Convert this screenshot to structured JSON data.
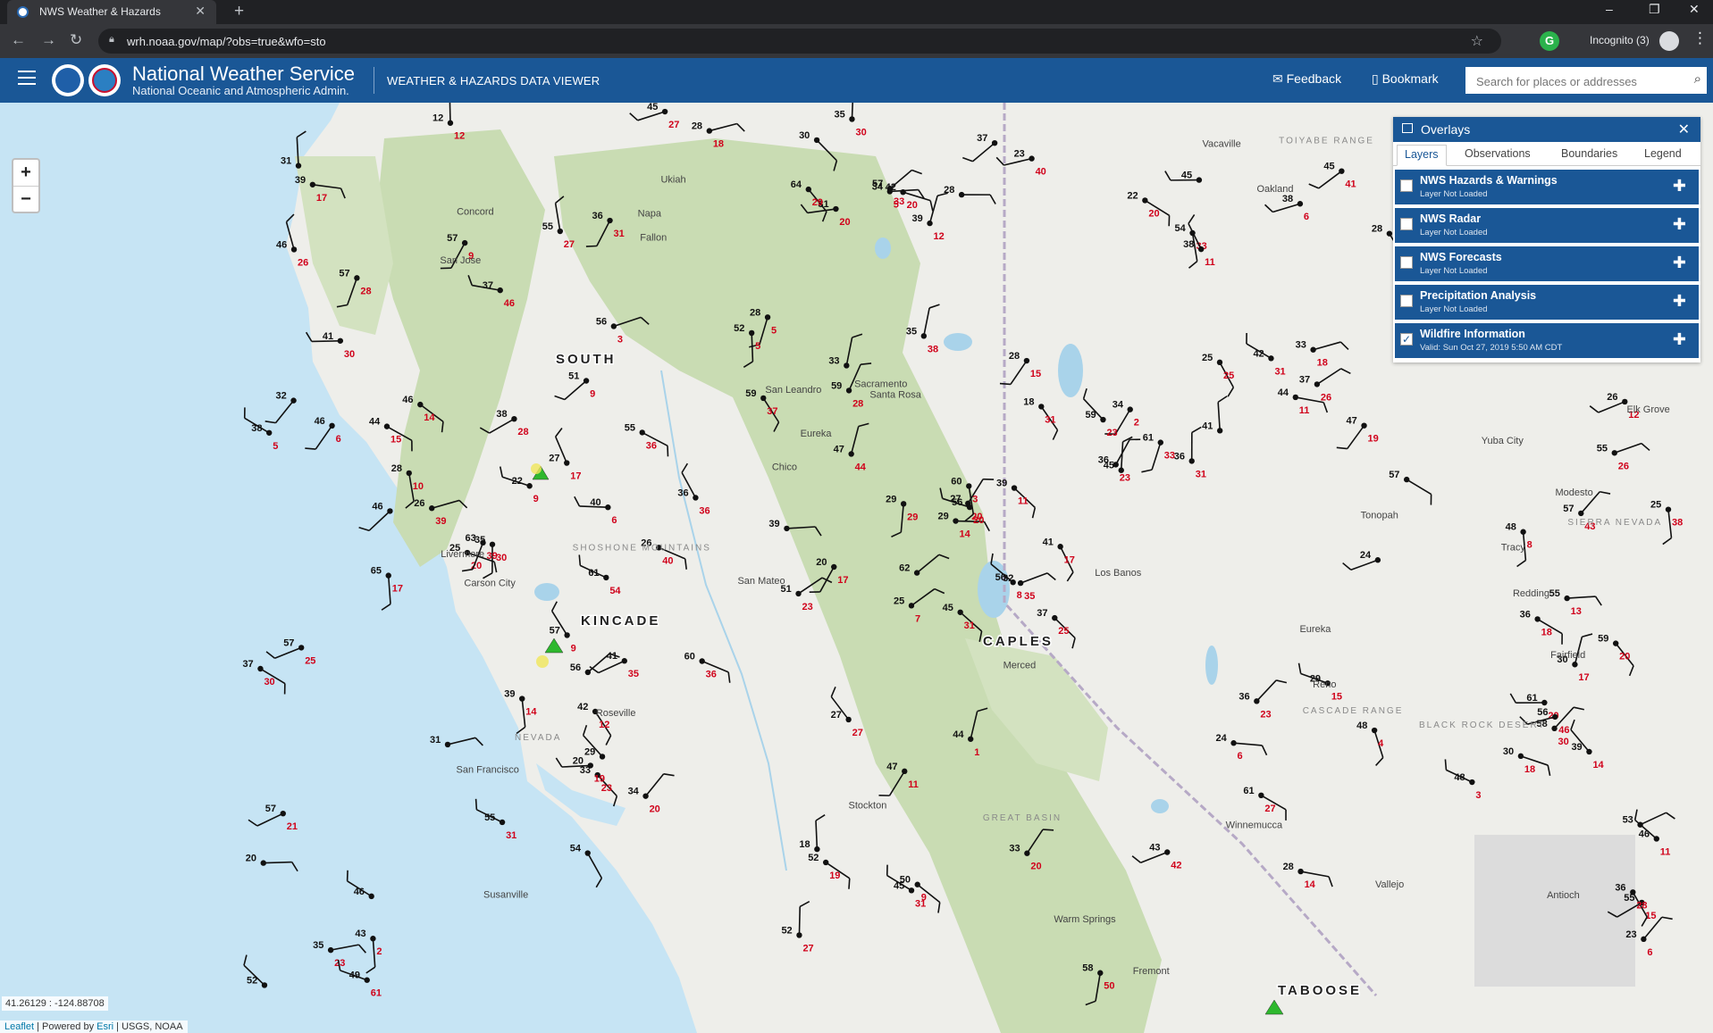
{
  "browser": {
    "tab_title": "NWS Weather & Hazards",
    "tab_close": "✕",
    "new_tab": "+",
    "url": "wrh.noaa.gov/map/?obs=true&wfo=sto",
    "profile_initial": "G",
    "incognito_label": "Incognito (3)",
    "window_controls": [
      "–",
      "❐",
      "✕"
    ]
  },
  "header": {
    "org_name": "National Weather Service",
    "org_subtitle": "National Oceanic and Atmospheric Admin.",
    "viewer_title": "WEATHER & HAZARDS DATA VIEWER",
    "feedback_label": "✉ Feedback",
    "bookmark_label": "▯ Bookmark",
    "search_placeholder": "Search for places or addresses"
  },
  "map": {
    "zoom_in": "+",
    "zoom_out": "−",
    "coordinates": "41.26129 : -124.88708",
    "attribution_leaflet": "Leaflet",
    "attribution_rest": " | Powered by ",
    "attribution_esri": "Esri",
    "attribution_end": " | USGS, NOAA",
    "colors": {
      "ocean": "#c6e4f4",
      "land": "#eeeeea",
      "forest": "#c9dcb3",
      "wind_barb": "#111111",
      "gust": "#d0021b"
    },
    "fire_labels": [
      "SOUTH",
      "KINCADE",
      "CAPLES",
      "TABOOSE"
    ],
    "place_labels": [
      "Eureka",
      "Redding",
      "Susanville",
      "Ukiah",
      "Santa Rosa",
      "Vallejo",
      "San Francisco",
      "Oakland",
      "San Leandro",
      "Fremont",
      "San Jose",
      "Livermore",
      "Concord",
      "Antioch",
      "Stockton",
      "Modesto",
      "Merced",
      "Los Banos",
      "Sacramento",
      "Roseville",
      "Elk Grove",
      "Yuba City",
      "Chico",
      "Fairfield",
      "Vacaville",
      "Napa",
      "Reno",
      "Carson City",
      "Fallon",
      "Tonopah",
      "Warm Springs",
      "Winnemucca",
      "Eureka",
      "San Mateo",
      "Tracy",
      "BLACK ROCK DESERT",
      "CASCADE RANGE",
      "SHOSHONE MOUNTAINS",
      "GREAT BASIN",
      "NEVADA",
      "SIERRA NEVADA",
      "TOIYABE RANGE"
    ],
    "stations": [
      {
        "t": "45",
        "g": "31"
      },
      {
        "t": "40",
        "g": "6"
      },
      {
        "t": "46",
        "g": ""
      },
      {
        "t": "33",
        "g": ""
      },
      {
        "t": "45",
        "g": ""
      },
      {
        "t": "42",
        "g": "12"
      },
      {
        "t": "41",
        "g": "17"
      },
      {
        "t": "35",
        "g": "23"
      },
      {
        "t": "26",
        "g": "39"
      },
      {
        "t": "22",
        "g": "9"
      },
      {
        "t": "25",
        "g": "25"
      },
      {
        "t": "25",
        "g": "38"
      },
      {
        "t": "18",
        "g": "31"
      },
      {
        "t": "47",
        "g": "19"
      },
      {
        "t": "43",
        "g": "2"
      },
      {
        "t": "48",
        "g": "8"
      },
      {
        "t": "45",
        "g": ""
      },
      {
        "t": "54",
        "g": "33"
      },
      {
        "t": "42",
        "g": "20"
      },
      {
        "t": "27",
        "g": "27"
      },
      {
        "t": "26",
        "g": "12"
      },
      {
        "t": "27",
        "g": "20"
      },
      {
        "t": "29",
        "g": "29"
      },
      {
        "t": "33",
        "g": "23"
      },
      {
        "t": "34",
        "g": "20"
      },
      {
        "t": "23",
        "g": "6"
      },
      {
        "t": "29",
        "g": "15"
      },
      {
        "t": "32",
        "g": ""
      },
      {
        "t": "27",
        "g": "17"
      },
      {
        "t": "33",
        "g": "18"
      },
      {
        "t": "38",
        "g": "5"
      },
      {
        "t": "34",
        "g": "5"
      },
      {
        "t": "45",
        "g": "31"
      },
      {
        "t": "39",
        "g": "12"
      },
      {
        "t": "57",
        "g": "13"
      },
      {
        "t": "46",
        "g": "26"
      },
      {
        "t": "36",
        "g": "23"
      },
      {
        "t": "54",
        "g": ""
      },
      {
        "t": "39",
        "g": "17"
      },
      {
        "t": "33",
        "g": "20"
      },
      {
        "t": "25",
        "g": "20"
      },
      {
        "t": "26",
        "g": "40"
      },
      {
        "t": "28",
        "g": "5"
      },
      {
        "t": "28",
        "g": "9"
      },
      {
        "t": "37",
        "g": "30"
      },
      {
        "t": "31",
        "g": "20"
      },
      {
        "t": "35",
        "g": "30"
      },
      {
        "t": "47",
        "g": "11"
      },
      {
        "t": "39",
        "g": "14"
      },
      {
        "t": "55",
        "g": "36"
      },
      {
        "t": "53",
        "g": "48"
      },
      {
        "t": "57",
        "g": "28"
      },
      {
        "t": "57",
        "g": "25"
      },
      {
        "t": "51",
        "g": "23"
      },
      {
        "t": "39",
        "g": "11"
      },
      {
        "t": "61",
        "g": "20"
      },
      {
        "t": "56",
        "g": "46"
      },
      {
        "t": "55",
        "g": "15"
      },
      {
        "t": "44",
        "g": "1"
      },
      {
        "t": "55",
        "g": "13"
      },
      {
        "t": "43",
        "g": "42"
      },
      {
        "t": "49",
        "g": "61"
      },
      {
        "t": "36",
        "g": "31"
      },
      {
        "t": "24",
        "g": ""
      },
      {
        "t": "30",
        "g": "18"
      },
      {
        "t": "39",
        "g": ""
      },
      {
        "t": "38",
        "g": "11"
      },
      {
        "t": "37",
        "g": "46"
      },
      {
        "t": "28",
        "g": "18"
      },
      {
        "t": "37",
        "g": ""
      },
      {
        "t": "39",
        "g": "14"
      },
      {
        "t": "37",
        "g": "26"
      },
      {
        "t": "36",
        "g": "23"
      },
      {
        "t": "38",
        "g": "28"
      },
      {
        "t": "36",
        "g": "18"
      },
      {
        "t": "35",
        "g": "30"
      },
      {
        "t": "20",
        "g": "17"
      },
      {
        "t": "31",
        "g": ""
      },
      {
        "t": "25",
        "g": "7"
      },
      {
        "t": "28",
        "g": "10"
      },
      {
        "t": "30",
        "g": ""
      },
      {
        "t": "28",
        "g": "14"
      },
      {
        "t": "28",
        "g": "15"
      },
      {
        "t": "20",
        "g": "19"
      },
      {
        "t": "56",
        "g": ""
      },
      {
        "t": "55",
        "g": "26"
      },
      {
        "t": "57",
        "g": ""
      },
      {
        "t": "55",
        "g": "27"
      },
      {
        "t": "58",
        "g": "50"
      },
      {
        "t": "59",
        "g": "37"
      },
      {
        "t": "30",
        "g": "17"
      },
      {
        "t": "42",
        "g": "31"
      },
      {
        "t": "31",
        "g": ""
      },
      {
        "t": "34",
        "g": "2"
      },
      {
        "t": "37",
        "g": "25"
      },
      {
        "t": "18",
        "g": ""
      },
      {
        "t": "56",
        "g": "8"
      },
      {
        "t": "64",
        "g": "29"
      },
      {
        "t": "52",
        "g": "27"
      },
      {
        "t": "57",
        "g": "43"
      },
      {
        "t": "57",
        "g": "33"
      },
      {
        "t": "52",
        "g": "5"
      },
      {
        "t": "46",
        "g": "6"
      },
      {
        "t": "46",
        "g": "11"
      },
      {
        "t": "23",
        "g": "40"
      },
      {
        "t": "63",
        "g": "39"
      },
      {
        "t": "61",
        "g": "54"
      },
      {
        "t": "57",
        "g": "9"
      },
      {
        "t": "28",
        "g": ""
      },
      {
        "t": "29",
        "g": "14"
      },
      {
        "t": "22",
        "g": "20"
      },
      {
        "t": "36",
        "g": "36"
      },
      {
        "t": "36",
        "g": "28"
      },
      {
        "t": "20",
        "g": ""
      },
      {
        "t": "48",
        "g": "3"
      },
      {
        "t": "28",
        "g": "49"
      },
      {
        "t": "60",
        "g": "36"
      },
      {
        "t": "61",
        "g": "33"
      },
      {
        "t": "59",
        "g": "20"
      },
      {
        "t": "24",
        "g": "6"
      },
      {
        "t": "36",
        "g": "31"
      },
      {
        "t": "41",
        "g": "30"
      },
      {
        "t": "32",
        "g": "35"
      },
      {
        "t": "44",
        "g": "15"
      },
      {
        "t": "57",
        "g": "9"
      },
      {
        "t": "46",
        "g": "14"
      },
      {
        "t": "59",
        "g": "28"
      },
      {
        "t": "62",
        "g": ""
      },
      {
        "t": "41",
        "g": ""
      },
      {
        "t": "35",
        "g": "38"
      },
      {
        "t": "41",
        "g": "35"
      },
      {
        "t": "50",
        "g": "9"
      },
      {
        "t": "60",
        "g": "3"
      },
      {
        "t": "48",
        "g": "4"
      },
      {
        "t": "38",
        "g": "6"
      },
      {
        "t": "45",
        "g": "41"
      },
      {
        "t": "45",
        "g": "27"
      },
      {
        "t": "44",
        "g": "11"
      },
      {
        "t": "56",
        "g": "20"
      },
      {
        "t": "57",
        "g": "21"
      },
      {
        "t": "61",
        "g": "27"
      },
      {
        "t": "53",
        "g": ""
      },
      {
        "t": "51",
        "g": "9"
      },
      {
        "t": "58",
        "g": "30"
      },
      {
        "t": "47",
        "g": "44"
      },
      {
        "t": "55",
        "g": "31"
      },
      {
        "t": "59",
        "g": "23"
      },
      {
        "t": "46",
        "g": ""
      },
      {
        "t": "65",
        "g": "17"
      },
      {
        "t": "52",
        "g": ""
      },
      {
        "t": "56",
        "g": "3"
      },
      {
        "t": "29",
        "g": ""
      },
      {
        "t": "52",
        "g": "19"
      },
      {
        "t": "12",
        "g": "12"
      }
    ]
  },
  "overlays": {
    "title": "Overlays",
    "close": "✕",
    "tabs": [
      "Layers",
      "Observations",
      "Boundaries",
      "Legend"
    ],
    "layers": [
      {
        "name": "NWS Hazards & Warnings",
        "status": "Layer Not Loaded",
        "checked": ""
      },
      {
        "name": "NWS Radar",
        "status": "Layer Not Loaded",
        "checked": ""
      },
      {
        "name": "NWS Forecasts",
        "status": "Layer Not Loaded",
        "checked": ""
      },
      {
        "name": "Precipitation Analysis",
        "status": "Layer Not Loaded",
        "checked": ""
      },
      {
        "name": "Wildfire Information",
        "status": "Valid: Sun Oct 27, 2019 5:50 AM CDT",
        "checked": "✓"
      }
    ],
    "expand": "✚"
  }
}
